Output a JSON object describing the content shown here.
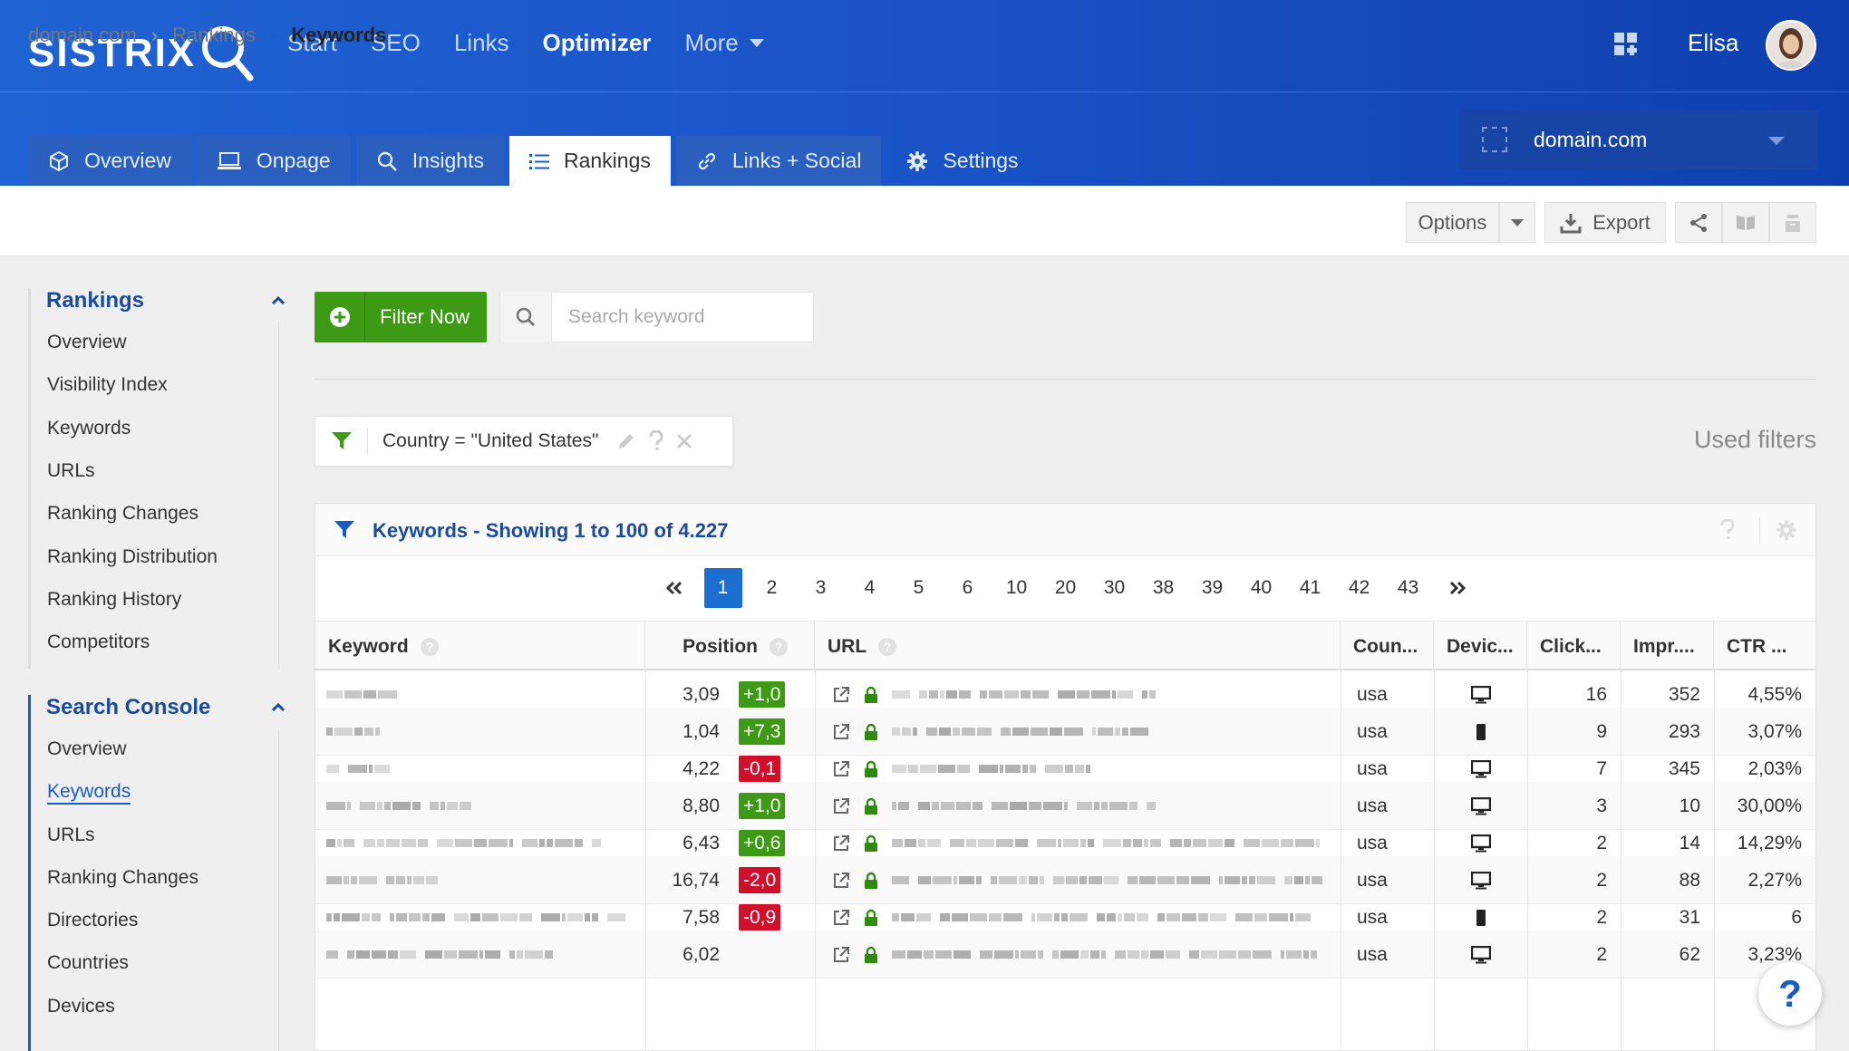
{
  "brand": {
    "logo": "SISTRIX"
  },
  "topnav": {
    "items": [
      "Start",
      "SEO",
      "Links",
      "Optimizer",
      "More"
    ],
    "active": "Optimizer",
    "user": "Elisa"
  },
  "tabs": [
    {
      "label": "Overview",
      "icon": "cube-icon"
    },
    {
      "label": "Onpage",
      "icon": "laptop-icon"
    },
    {
      "label": "Insights",
      "icon": "search-icon"
    },
    {
      "label": "Rankings",
      "icon": "list-icon",
      "active": true
    },
    {
      "label": "Links + Social",
      "icon": "link-icon"
    },
    {
      "label": "Settings",
      "icon": "gear-icon"
    }
  ],
  "domain_selector": {
    "value": "domain.com"
  },
  "breadcrumb": {
    "items": [
      "domain.com",
      "Rankings",
      "Keywords"
    ]
  },
  "toolbar": {
    "options_label": "Options",
    "export_label": "Export"
  },
  "sidebar": {
    "groups": [
      {
        "title": "Rankings",
        "items": [
          "Overview",
          "Visibility Index",
          "Keywords",
          "URLs",
          "Ranking Changes",
          "Ranking Distribution",
          "Ranking History",
          "Competitors"
        ]
      },
      {
        "title": "Search Console",
        "items": [
          "Overview",
          "Keywords",
          "URLs",
          "Ranking Changes",
          "Directories",
          "Countries",
          "Devices"
        ],
        "selected": "Keywords"
      }
    ]
  },
  "filter": {
    "button_label": "Filter Now",
    "search_placeholder": "Search keyword",
    "active_filter": "Country = \"United States\"",
    "used_filters_label": "Used filters"
  },
  "table": {
    "title": "Keywords - Showing 1 to 100 of 4.227",
    "pages": [
      "1",
      "2",
      "3",
      "4",
      "5",
      "6",
      "10",
      "20",
      "30",
      "38",
      "39",
      "40",
      "41",
      "42",
      "43"
    ],
    "current_page": "1",
    "columns": [
      "Keyword",
      "Position",
      "URL",
      "Coun...",
      "Devic...",
      "Click...",
      "Impr....",
      "CTR ..."
    ],
    "rows": [
      {
        "position": "3,09",
        "change": "+1,0",
        "dir": "up",
        "country": "usa",
        "device": "desktop",
        "clicks": "16",
        "impressions": "352",
        "ctr": "4,55%"
      },
      {
        "position": "1,04",
        "change": "+7,3",
        "dir": "up",
        "country": "usa",
        "device": "mobile",
        "clicks": "9",
        "impressions": "293",
        "ctr": "3,07%"
      },
      {
        "position": "4,22",
        "change": "-0,1",
        "dir": "down",
        "country": "usa",
        "device": "desktop",
        "clicks": "7",
        "impressions": "345",
        "ctr": "2,03%"
      },
      {
        "position": "8,80",
        "change": "+1,0",
        "dir": "up",
        "country": "usa",
        "device": "desktop",
        "clicks": "3",
        "impressions": "10",
        "ctr": "30,00%"
      },
      {
        "position": "6,43",
        "change": "+0,6",
        "dir": "up",
        "country": "usa",
        "device": "desktop",
        "clicks": "2",
        "impressions": "14",
        "ctr": "14,29%"
      },
      {
        "position": "16,74",
        "change": "-2,0",
        "dir": "down",
        "country": "usa",
        "device": "desktop",
        "clicks": "2",
        "impressions": "88",
        "ctr": "2,27%"
      },
      {
        "position": "7,58",
        "change": "-0,9",
        "dir": "down",
        "country": "usa",
        "device": "mobile",
        "clicks": "2",
        "impressions": "31",
        "ctr": "6"
      },
      {
        "position": "6,02",
        "change": "",
        "dir": "none",
        "country": "usa",
        "device": "desktop",
        "clicks": "2",
        "impressions": "62",
        "ctr": "3,23%"
      }
    ]
  },
  "help": {
    "label": "?"
  }
}
